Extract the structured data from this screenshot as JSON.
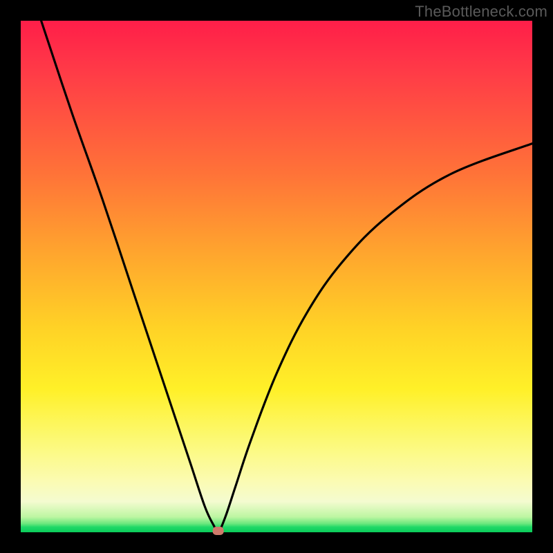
{
  "watermark": "TheBottleneck.com",
  "chart_data": {
    "type": "line",
    "title": "",
    "xlabel": "",
    "ylabel": "",
    "xlim": [
      0,
      100
    ],
    "ylim": [
      0,
      100
    ],
    "grid": false,
    "legend": false,
    "background_gradient": {
      "direction": "vertical",
      "stops": [
        {
          "pos": 0,
          "color": "#ff1e49"
        },
        {
          "pos": 30,
          "color": "#ff7338"
        },
        {
          "pos": 60,
          "color": "#ffd226"
        },
        {
          "pos": 82,
          "color": "#fbfbb2"
        },
        {
          "pos": 99,
          "color": "#0acc5a"
        }
      ]
    },
    "series": [
      {
        "name": "left-descent",
        "x": [
          4,
          10,
          16,
          22,
          28,
          33,
          36,
          37.8,
          38.6
        ],
        "y": [
          100,
          82,
          65,
          47,
          29,
          14,
          5,
          1.2,
          0
        ]
      },
      {
        "name": "right-ascent",
        "x": [
          38.6,
          40,
          42,
          45,
          50,
          56,
          63,
          72,
          84,
          100
        ],
        "y": [
          0,
          3,
          9,
          18,
          31,
          43,
          53,
          62,
          70,
          76
        ]
      }
    ],
    "marker": {
      "name": "minimum-marker",
      "x": 38.6,
      "y": 0,
      "color": "#cf7a6b",
      "shape": "rounded-rect"
    }
  }
}
